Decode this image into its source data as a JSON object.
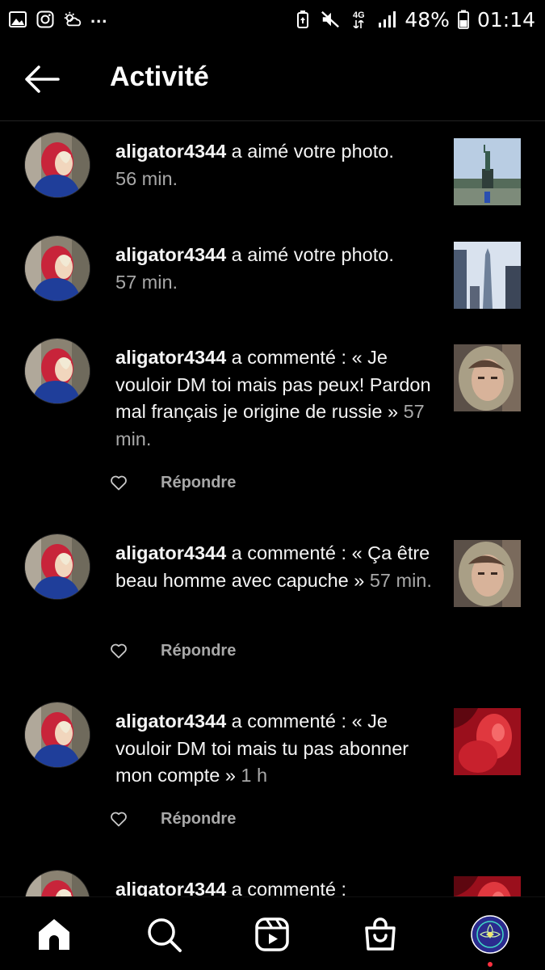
{
  "status_bar": {
    "dots": "...",
    "network": "4G",
    "battery": "48%",
    "time": "01:14"
  },
  "header": {
    "title": "Activité"
  },
  "notifications": [
    {
      "username": "aligator4344",
      "text": " a aimé votre photo.",
      "time": "56 min.",
      "thumb": "statue-of-liberty-photo"
    },
    {
      "username": "aligator4344",
      "text": " a aimé votre photo.",
      "time": "57 min.",
      "thumb": "skyscraper-photo"
    },
    {
      "username": "aligator4344",
      "text": " a commenté : « Je vouloir DM toi mais pas peux! Pardon mal français je origine de russie »",
      "time": " 57 min.",
      "reply": "Répondre",
      "thumb": "hooded-portrait-photo"
    },
    {
      "username": "aligator4344",
      "text": " a commenté : « Ça être beau homme avec capuche »",
      "time": " 57 min.",
      "reply": "Répondre",
      "thumb": "hooded-portrait-photo"
    },
    {
      "username": "aligator4344",
      "text": " a commenté : « Je vouloir DM toi mais tu pas abonner mon compte »",
      "time": " 1 h",
      "reply": "Répondre",
      "thumb": "red-tinted-photo"
    },
    {
      "username": "aligator4344",
      "text": " a commenté :",
      "time": "",
      "thumb": "red-tinted-photo"
    }
  ],
  "bottom_nav": {
    "items": [
      "home-icon",
      "search-icon",
      "reels-icon",
      "shop-icon",
      "profile-avatar"
    ],
    "accent": "#ff3040"
  }
}
